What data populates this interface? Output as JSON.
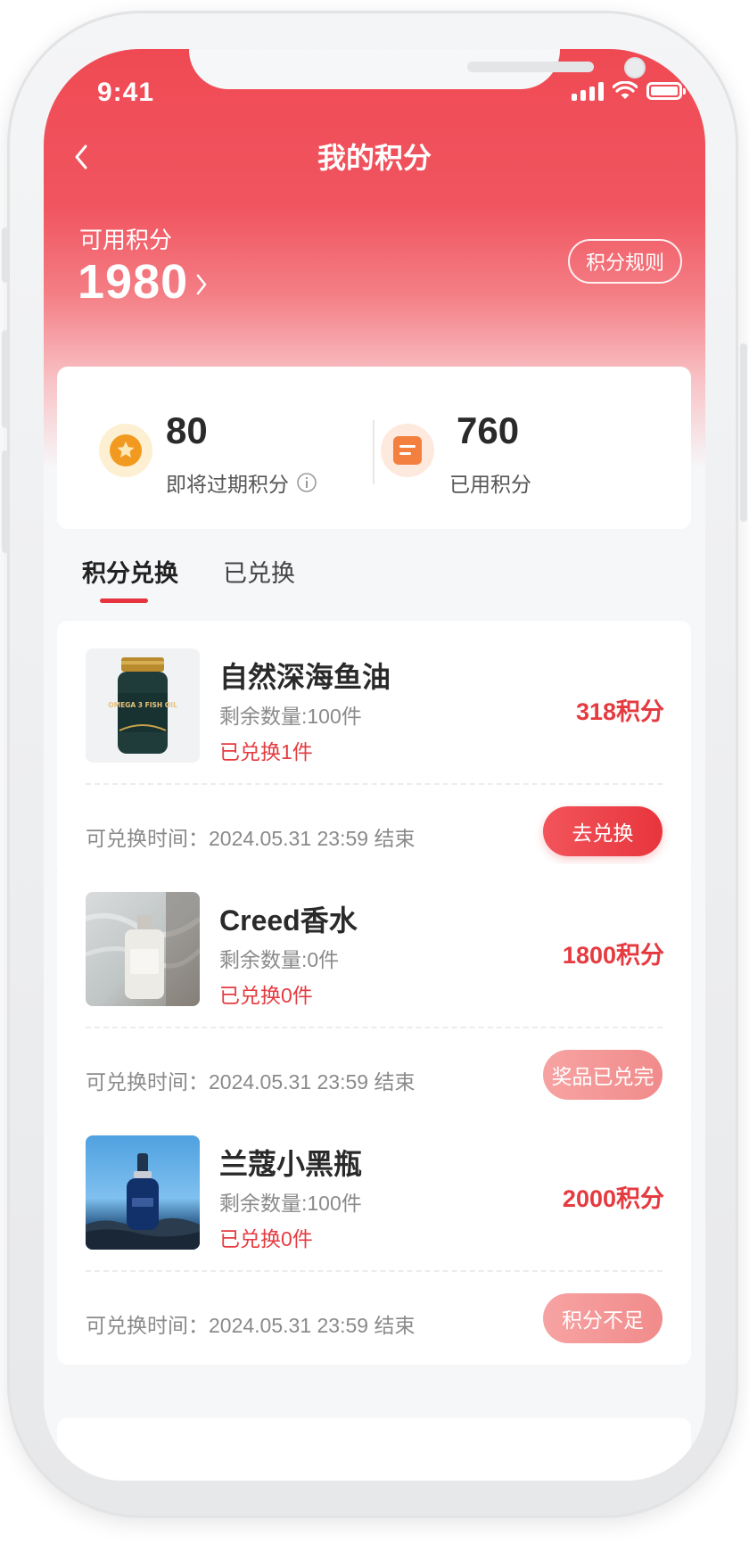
{
  "status_bar": {
    "time": "9:41"
  },
  "header": {
    "title": "我的积分"
  },
  "points": {
    "label": "可用积分",
    "value": "1980",
    "rules_button": "积分规则"
  },
  "stats": [
    {
      "value": "80",
      "label": "即将过期积分",
      "icon": "star-icon",
      "color": "#f29a1f"
    },
    {
      "value": "760",
      "label": "已用积分",
      "icon": "document-icon",
      "color": "#f4803f"
    }
  ],
  "tabs": [
    {
      "label": "积分兑换",
      "active": true
    },
    {
      "label": "已兑换",
      "active": false
    }
  ],
  "products": [
    {
      "name": "自然深海鱼油",
      "image_icon": "fish-oil-bottle-image",
      "image_text": "OMEGA 3 FISH OIL",
      "remaining": "剩余数量:100件",
      "redeemed": "已兑换1件",
      "price": "318积分",
      "time": "可兑换时间：2024.05.31 23:59 结束",
      "button": "去兑换",
      "button_state": "enabled"
    },
    {
      "name": "Creed香水",
      "image_icon": "perfume-bottle-image",
      "remaining": "剩余数量:0件",
      "redeemed": "已兑换0件",
      "price": "1800积分",
      "time": "可兑换时间：2024.05.31 23:59 结束",
      "button": "奖品已兑完",
      "button_state": "disabled"
    },
    {
      "name": "兰蔻小黑瓶",
      "image_icon": "serum-bottle-image",
      "remaining": "剩余数量:100件",
      "redeemed": "已兑换0件",
      "price": "2000积分",
      "time": "可兑换时间：2024.05.31 23:59 结束",
      "button": "积分不足",
      "button_state": "disabled"
    }
  ],
  "colors": {
    "brand_red": "#e8343e",
    "price_red": "#e53b40",
    "background": "#f6f7f9"
  }
}
